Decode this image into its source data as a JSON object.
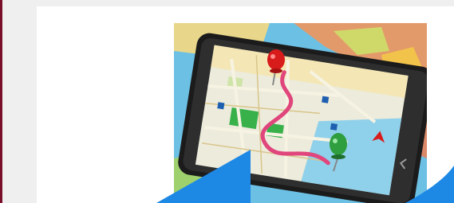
{
  "page": {
    "accent_color": "#7a0f2a",
    "brand_blue": "#1e88e5"
  },
  "hero_image": {
    "subject": "gps-navigation-smartphone-on-world-map",
    "icon": "map-pin-icon",
    "start_pin_color": "#2e9e3e",
    "end_pin_color": "#d81b1b",
    "route_color": "#e0457b"
  }
}
